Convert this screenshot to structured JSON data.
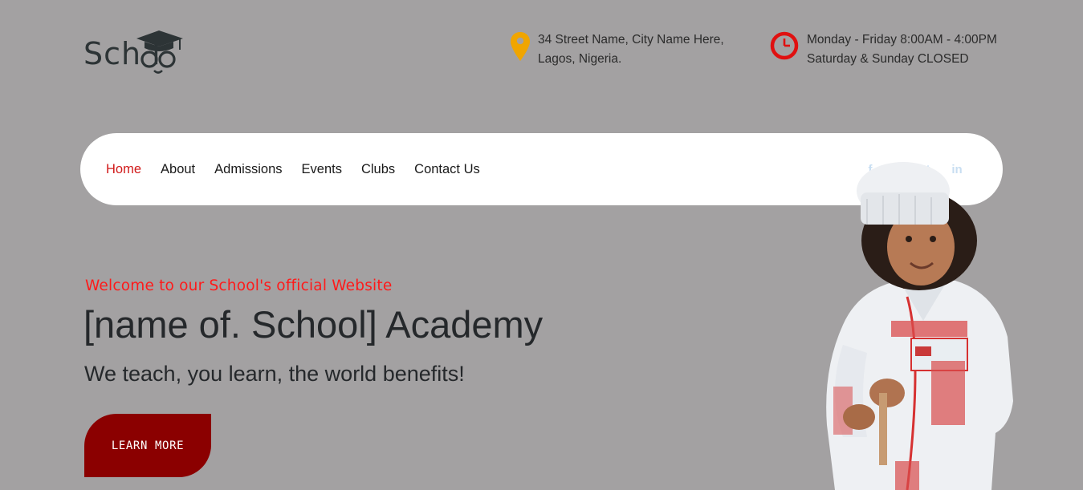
{
  "header": {
    "logo_text": "Sch  l",
    "address": {
      "line1": "34 Street Name, City Name Here,",
      "line2": "Lagos, Nigeria.",
      "icon": "map-pin-icon",
      "icon_color": "#f0a500"
    },
    "hours": {
      "line1": "Monday - Friday 8:00AM - 4:00PM",
      "line2": "Saturday & Sunday CLOSED",
      "icon": "clock-icon",
      "icon_color": "#e01010"
    }
  },
  "nav": {
    "links": [
      {
        "label": "Home",
        "active": true
      },
      {
        "label": "About",
        "active": false
      },
      {
        "label": "Admissions",
        "active": false
      },
      {
        "label": "Events",
        "active": false
      },
      {
        "label": "Clubs",
        "active": false
      },
      {
        "label": "Contact Us",
        "active": false
      }
    ],
    "socials": [
      {
        "glyph": "f",
        "icon": "facebook-icon"
      },
      {
        "glyph": "◎",
        "icon": "instagram-icon"
      },
      {
        "glyph": "t",
        "icon": "twitter-icon"
      },
      {
        "glyph": "in",
        "icon": "linkedin-icon"
      }
    ]
  },
  "hero": {
    "welcome": "Welcome to our School's official Website",
    "title": "[name of. School] Academy",
    "tagline": "We teach, you learn, the world benefits!",
    "button_label": "LEARN MORE"
  },
  "colors": {
    "background": "#a3a1a2",
    "accent_red": "#d11a1a",
    "button_bg": "#8b0000"
  }
}
